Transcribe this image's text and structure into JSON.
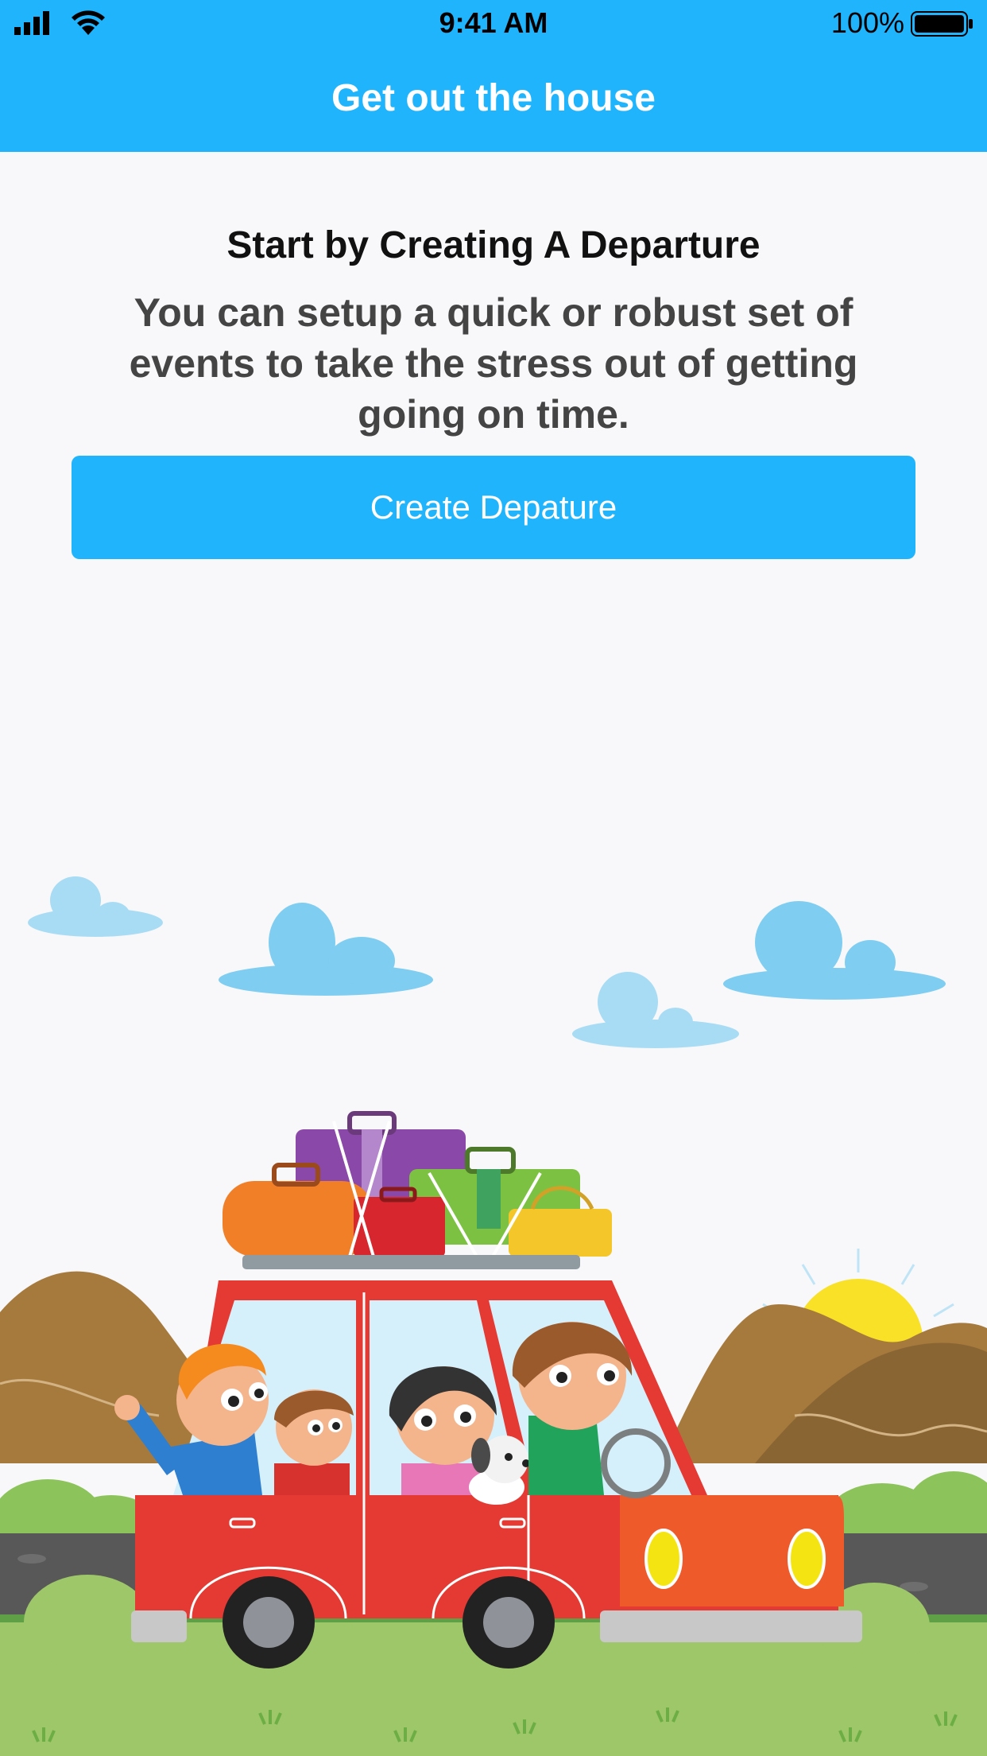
{
  "status_bar": {
    "time": "9:41 AM",
    "battery_percent": "100%"
  },
  "nav": {
    "title": "Get out the house"
  },
  "main": {
    "heading": "Start by Creating A Departure",
    "description": "You can setup a quick or robust set of events to take the stress out of getting going on time.",
    "cta_label": "Create Depature"
  },
  "icons": [
    "signal-icon",
    "wifi-icon",
    "battery-icon"
  ],
  "colors": {
    "accent": "#20b4fc",
    "background": "#f8f8fa",
    "heading_text": "#111111",
    "body_text": "#444444"
  }
}
